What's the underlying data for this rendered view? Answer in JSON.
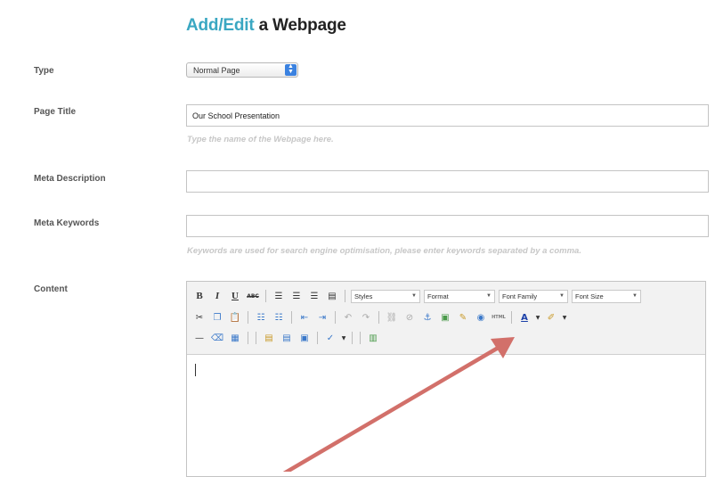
{
  "page": {
    "title_accent": "Add/Edit",
    "title_rest": " a Webpage"
  },
  "fields": {
    "type_label": "Type",
    "type_value": "Normal Page",
    "page_title_label": "Page Title",
    "page_title_value": "Our School Presentation",
    "page_title_hint": "Type the name of the Webpage here.",
    "meta_description_label": "Meta Description",
    "meta_description_value": "",
    "meta_keywords_label": "Meta Keywords",
    "meta_keywords_value": "",
    "meta_keywords_hint": "Keywords are used for search engine optimisation, please enter keywords separated by a comma.",
    "content_label": "Content"
  },
  "editor": {
    "styles": "Styles",
    "format": "Format",
    "font_family": "Font Family",
    "font_size": "Font Size",
    "bold": "B",
    "italic": "I",
    "underline": "U",
    "strikethrough": "ABC",
    "html": "HTML"
  },
  "colors": {
    "accent": "#3aa7c2",
    "annotation_arrow": "#d2706a"
  }
}
